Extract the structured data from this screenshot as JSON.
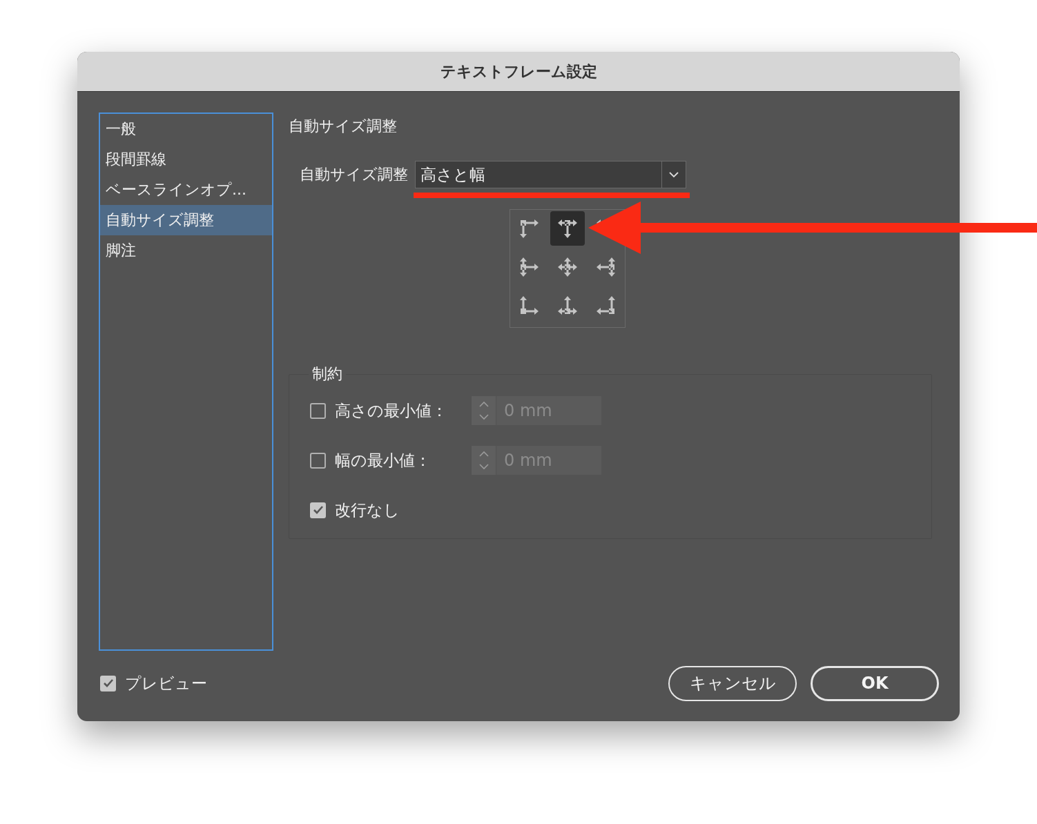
{
  "window": {
    "title": "テキストフレーム設定"
  },
  "sidebar": {
    "items": [
      {
        "label": "一般",
        "selected": false
      },
      {
        "label": "段間罫線",
        "selected": false
      },
      {
        "label": "ベースラインオプ...",
        "selected": false
      },
      {
        "label": "自動サイズ調整",
        "selected": true
      },
      {
        "label": "脚注",
        "selected": false
      }
    ]
  },
  "section_title": "自動サイズ調整",
  "auto_size": {
    "label": "自動サイズ調整",
    "value": "高さと幅"
  },
  "reference_point": {
    "anchors": [
      {
        "selected": false
      },
      {
        "selected": true
      },
      {
        "selected": false
      },
      {
        "selected": false
      },
      {
        "selected": false
      },
      {
        "selected": false
      },
      {
        "selected": false
      },
      {
        "selected": false
      },
      {
        "selected": false
      }
    ]
  },
  "constraints": {
    "title": "制約",
    "options": [
      {
        "kind": "spinner",
        "label": "高さの最小値：",
        "checked": false,
        "value": "0 mm",
        "disabled": true
      },
      {
        "kind": "spinner",
        "label": "幅の最小値：",
        "checked": false,
        "value": "0 mm",
        "disabled": true
      },
      {
        "kind": "check",
        "label": "改行なし",
        "checked": true
      }
    ]
  },
  "preview": {
    "label": "プレビュー",
    "checked": true
  },
  "buttons": [
    {
      "label": "キャンセル",
      "default": false
    },
    {
      "label": "OK",
      "default": true
    }
  ]
}
